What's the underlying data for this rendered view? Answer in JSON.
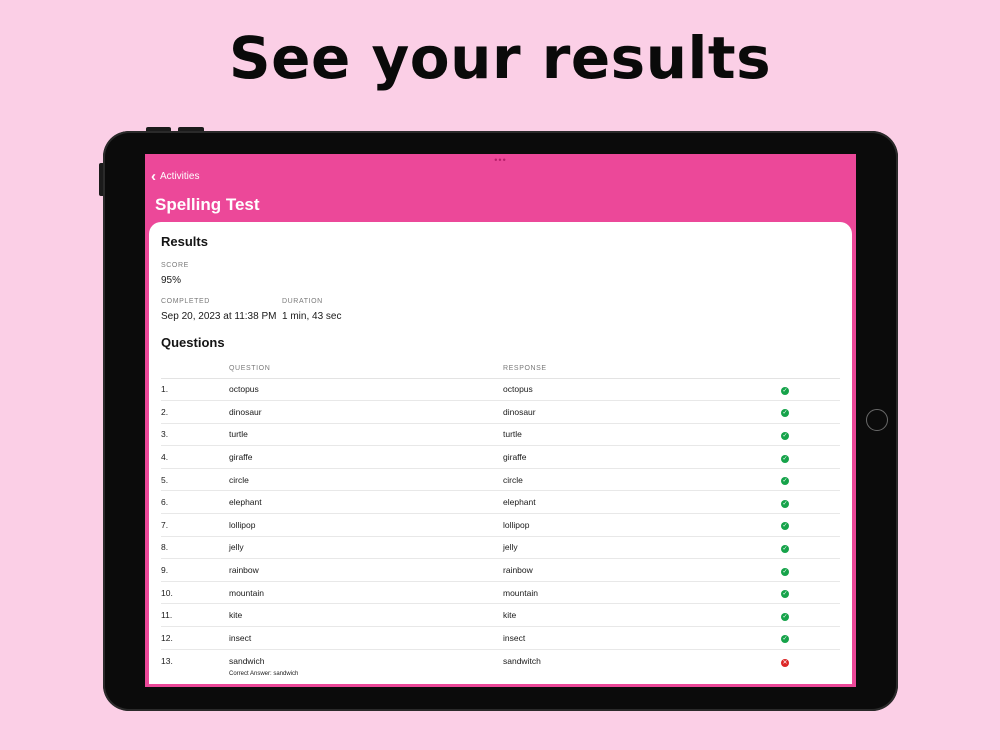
{
  "headline": "See your results",
  "nav": {
    "back_label": "Activities",
    "title": "Spelling Test"
  },
  "results": {
    "heading": "Results",
    "score_label": "SCORE",
    "score_value": "95%",
    "completed_label": "COMPLETED",
    "completed_value": "Sep 20, 2023 at 11:38 PM",
    "duration_label": "DURATION",
    "duration_value": "1 min, 43 sec"
  },
  "questions": {
    "heading": "Questions",
    "col_question": "QUESTION",
    "col_response": "RESPONSE",
    "rows": [
      {
        "num": "1.",
        "question": "octopus",
        "response": "octopus",
        "correct": true
      },
      {
        "num": "2.",
        "question": "dinosaur",
        "response": "dinosaur",
        "correct": true
      },
      {
        "num": "3.",
        "question": "turtle",
        "response": "turtle",
        "correct": true
      },
      {
        "num": "4.",
        "question": "giraffe",
        "response": "giraffe",
        "correct": true
      },
      {
        "num": "5.",
        "question": "circle",
        "response": "circle",
        "correct": true
      },
      {
        "num": "6.",
        "question": "elephant",
        "response": "elephant",
        "correct": true
      },
      {
        "num": "7.",
        "question": "lollipop",
        "response": "lollipop",
        "correct": true
      },
      {
        "num": "8.",
        "question": "jelly",
        "response": "jelly",
        "correct": true
      },
      {
        "num": "9.",
        "question": "rainbow",
        "response": "rainbow",
        "correct": true
      },
      {
        "num": "10.",
        "question": "mountain",
        "response": "mountain",
        "correct": true
      },
      {
        "num": "11.",
        "question": "kite",
        "response": "kite",
        "correct": true
      },
      {
        "num": "12.",
        "question": "insect",
        "response": "insect",
        "correct": true
      },
      {
        "num": "13.",
        "question": "sandwich",
        "response": "sandwitch",
        "correct": false,
        "correct_answer": "Correct Answer: sandwich"
      }
    ]
  },
  "colors": {
    "background": "#fbcfe6",
    "accent": "#ec4899",
    "correct": "#16a34a",
    "incorrect": "#dc2626"
  },
  "icons": {
    "back": "chevron-left-icon",
    "correct": "check-circle-icon",
    "incorrect": "x-circle-icon"
  }
}
